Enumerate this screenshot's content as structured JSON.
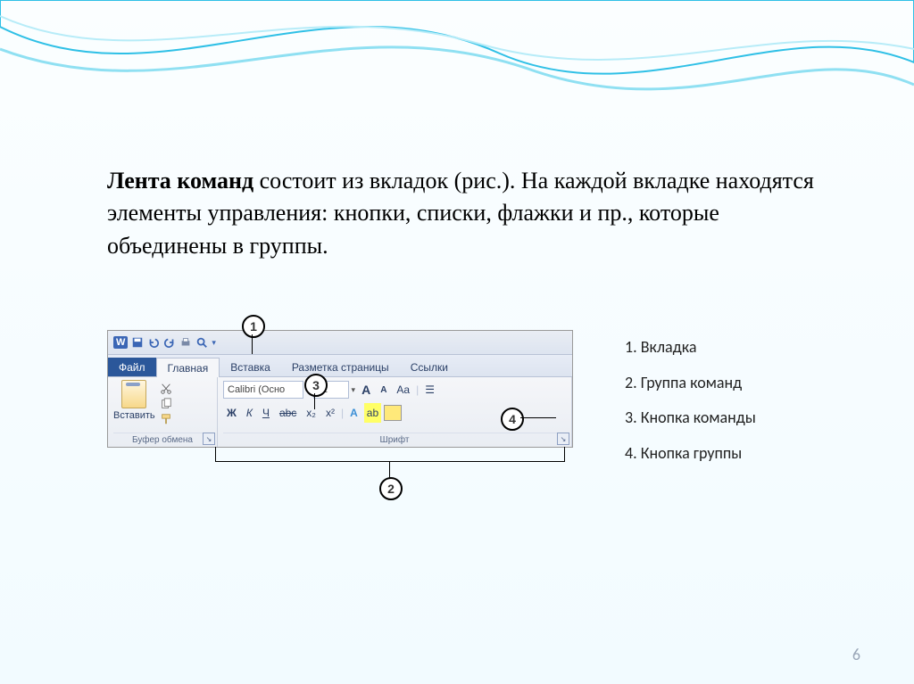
{
  "text": {
    "bold_lead": "Лента команд",
    "para_rest": " состоит из вкладок (рис.). На каждой вкладке находятся элементы управления: кнопки, списки, флажки и пр., которые объединены в группы."
  },
  "ribbon": {
    "app_letter": "W",
    "tabs": {
      "file": "Файл",
      "home": "Главная",
      "insert": "Вставка",
      "layout": "Разметка страницы",
      "refs": "Ссылки"
    },
    "groups": {
      "clipboard": "Буфер обмена",
      "font": "Шрифт"
    },
    "paste_label": "Вставить",
    "font_name": "Calibri (Осно",
    "font_size": "11",
    "bold": "Ж",
    "italic": "К",
    "underline": "Ч",
    "strike": "abc",
    "sub": "x₂",
    "sup": "x²",
    "grow": "A",
    "shrink": "A",
    "case": "Aa"
  },
  "callouts": {
    "c1": "1",
    "c2": "2",
    "c3": "3",
    "c4": "4"
  },
  "legend": {
    "l1": "1. Вкладка",
    "l2": "2. Группа команд",
    "l3": "3. Кнопка команды",
    "l4": "4. Кнопка группы"
  },
  "page_number": "6"
}
